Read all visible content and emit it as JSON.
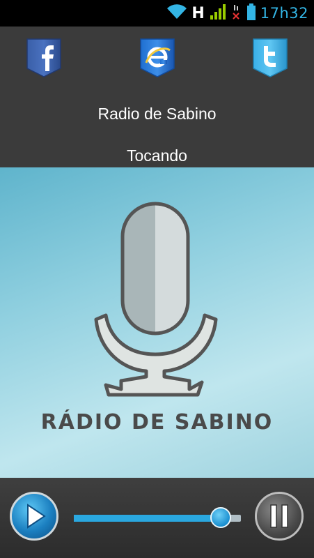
{
  "status_bar": {
    "time": "17h32",
    "icons": [
      "wifi-icon",
      "h-network-icon",
      "signal-icon",
      "no-sim-icon",
      "battery-icon"
    ],
    "network_letter": "H"
  },
  "header": {
    "social": [
      {
        "name": "facebook",
        "icon": "facebook-icon"
      },
      {
        "name": "internet-explorer",
        "icon": "browser-icon"
      },
      {
        "name": "twitter",
        "icon": "twitter-icon"
      }
    ],
    "station_name": "Radio de Sabino",
    "status": "Tocando"
  },
  "cover": {
    "title": "RÁDIO DE SABINO",
    "icon": "microphone-icon"
  },
  "player": {
    "play_icon": "play-icon",
    "pause_icon": "pause-icon",
    "volume_level": 0.88
  },
  "colors": {
    "accent": "#33b5e5",
    "header_bg": "#3b3b3b"
  }
}
